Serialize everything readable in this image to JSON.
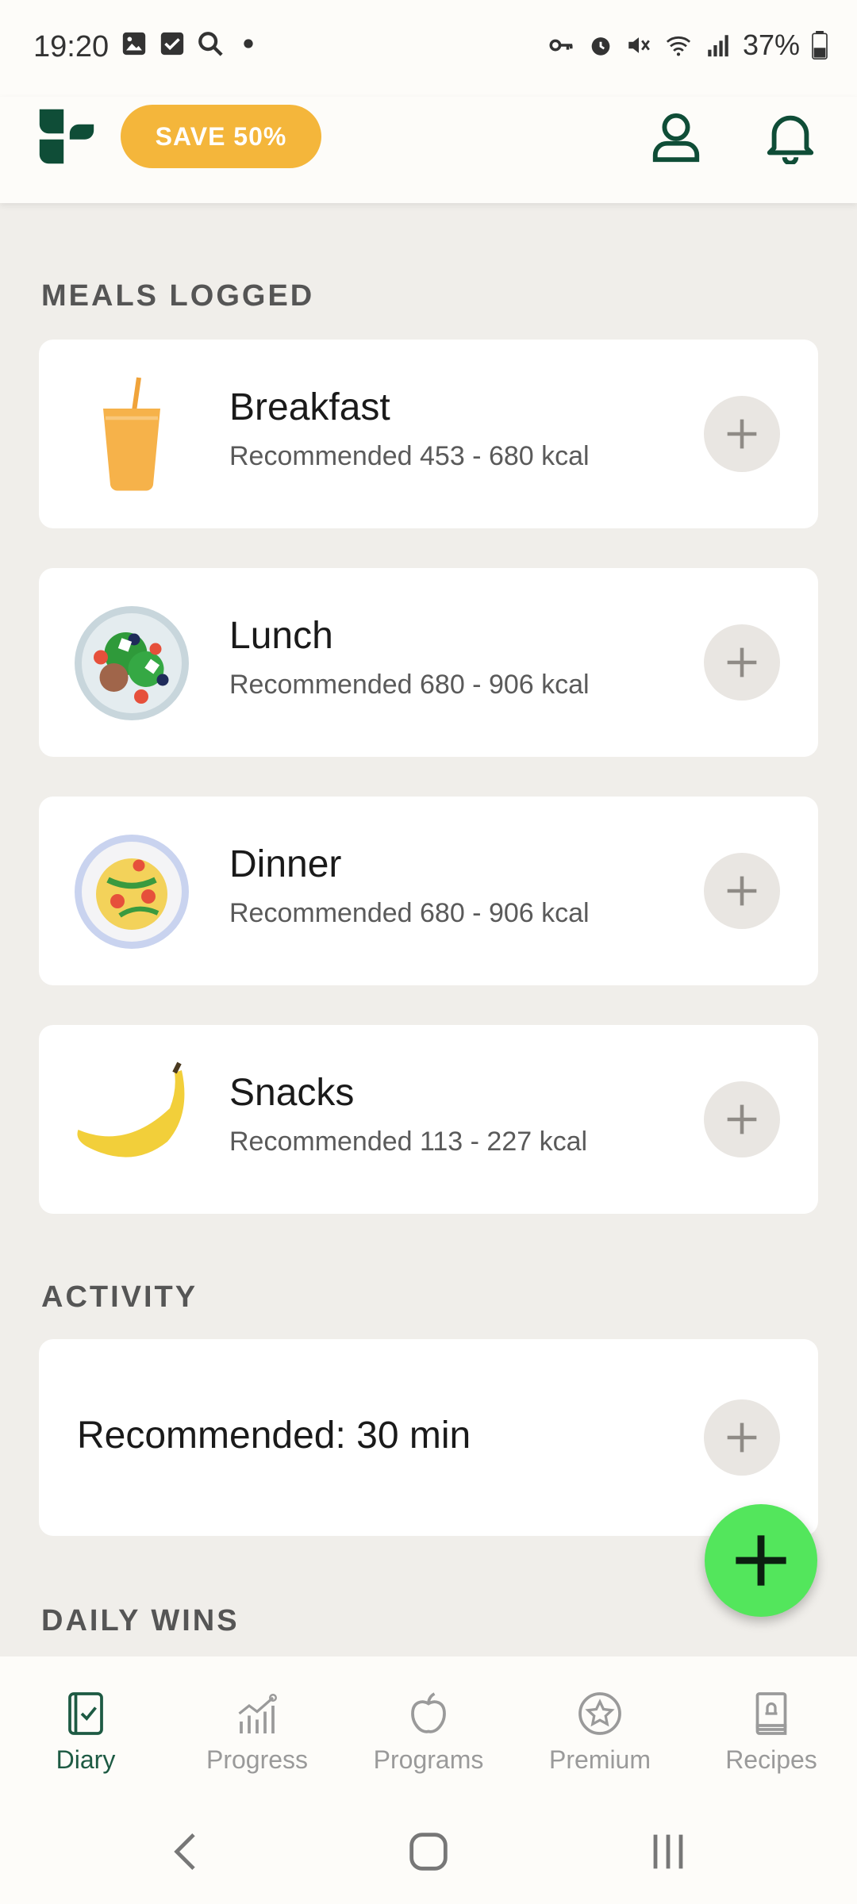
{
  "status_bar": {
    "time": "19:20",
    "battery": "37%",
    "left_icons": [
      "gallery-icon",
      "checkbox-icon",
      "search-icon",
      "dot-icon"
    ],
    "right_icons": [
      "key-icon",
      "alarm-icon",
      "mute-icon",
      "wifi-icon",
      "signal-icon",
      "battery-icon"
    ]
  },
  "header": {
    "promo_label": "SAVE 50%",
    "colors": {
      "brand": "#0f4d37",
      "promo": "#f4b63b"
    }
  },
  "sections": {
    "meals_title": "MEALS LOGGED",
    "activity_title": "ACTIVITY",
    "daily_wins_title": "DAILY WINS"
  },
  "meals": [
    {
      "name": "Breakfast",
      "recommended": "Recommended 453 - 680 kcal",
      "icon": "juice-icon"
    },
    {
      "name": "Lunch",
      "recommended": "Recommended 680 - 906 kcal",
      "icon": "salad-icon"
    },
    {
      "name": "Dinner",
      "recommended": "Recommended 680 - 906 kcal",
      "icon": "pasta-icon"
    },
    {
      "name": "Snacks",
      "recommended": "Recommended 113 - 227 kcal",
      "icon": "banana-icon"
    }
  ],
  "activity": {
    "recommended": "Recommended: 30 min"
  },
  "fab": {
    "color": "#53e65c"
  },
  "bottom_nav": [
    {
      "label": "Diary",
      "icon": "diary-icon",
      "active": true
    },
    {
      "label": "Progress",
      "icon": "progress-chart-icon",
      "active": false
    },
    {
      "label": "Programs",
      "icon": "apple-icon",
      "active": false
    },
    {
      "label": "Premium",
      "icon": "star-icon",
      "active": false
    },
    {
      "label": "Recipes",
      "icon": "recipe-book-icon",
      "active": false
    }
  ]
}
